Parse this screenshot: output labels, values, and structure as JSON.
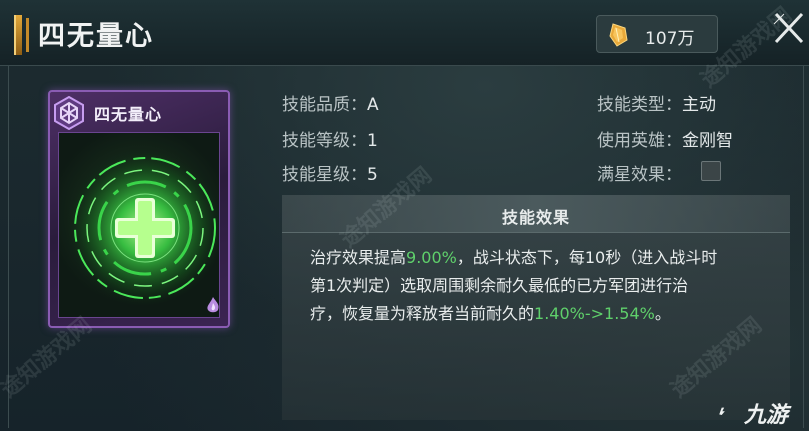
{
  "header": {
    "title": "四无量心",
    "currency": {
      "icon": "gold-crystal-icon",
      "value": "107万"
    },
    "close_icon": "close-icon"
  },
  "card": {
    "title": "四无量心",
    "badge_icon": "hexagon-badge-icon",
    "art_icon": "green-cross-heal-icon",
    "frame_color": "#8a5cb3",
    "glow_color": "#3fe04a"
  },
  "attributes": {
    "left": [
      {
        "label": "技能品质：",
        "value": "A"
      },
      {
        "label": "技能等级：",
        "value": "1"
      },
      {
        "label": "技能星级：",
        "value": "5"
      }
    ],
    "right": [
      {
        "label": "技能类型：",
        "value": "主动"
      },
      {
        "label": "使用英雄：",
        "value": "金刚智"
      },
      {
        "label": "满星效果：",
        "value": ""
      }
    ]
  },
  "effect": {
    "title": "技能效果",
    "line1_a": "治疗效果提高",
    "line1_hl": "9.00%",
    "line1_b": "，战斗状态下，每10秒（进入战斗时",
    "line2": "第1次判定）选取周围剩余耐久最低的已方军团进行治",
    "line3_a": "疗，恢复量为释放者当前耐久的",
    "line3_hl": "1.40%->1.54%",
    "line3_b": "。",
    "highlight_color": "#5fd06b"
  },
  "watermarks": [
    "途知游戏网",
    "途知游戏网",
    "途知游戏网",
    "途知游戏网"
  ],
  "logo": {
    "text": "九游"
  }
}
